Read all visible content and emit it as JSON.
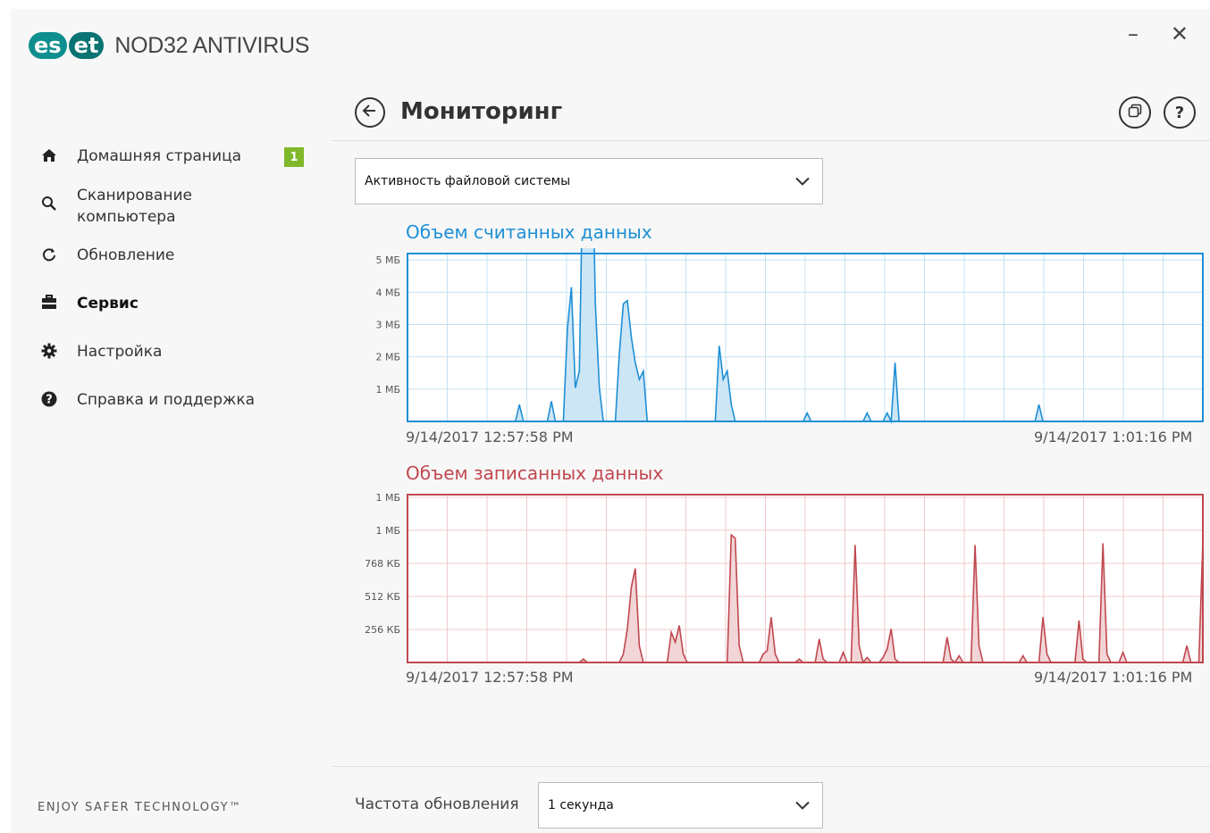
{
  "app": {
    "logo_left": "es",
    "logo_right": "et",
    "product": "NOD32 ANTIVIRUS",
    "minimize_label": "–",
    "close_label": "✕"
  },
  "sidebar": {
    "items": [
      {
        "label": "Домашняя страница",
        "icon": "home-icon",
        "badge": "1"
      },
      {
        "label": "Сканирование\nкомпьютера",
        "icon": "search-icon"
      },
      {
        "label": "Обновление",
        "icon": "refresh-icon"
      },
      {
        "label": "Сервис",
        "icon": "toolbox-icon",
        "active": true
      },
      {
        "label": "Настройка",
        "icon": "gear-icon"
      },
      {
        "label": "Справка и поддержка",
        "icon": "help-icon"
      }
    ],
    "tagline": "ENJOY SAFER TECHNOLOGY™"
  },
  "header": {
    "title": "Мониторинг",
    "back_icon": "back-arrow-icon",
    "help_symbol": "?"
  },
  "monitor": {
    "selected": "Активность файловой системы",
    "frequency_label": "Частота обновления",
    "frequency_value": "1 секунда"
  },
  "chart_data": [
    {
      "type": "area",
      "title": "Объем считанных данных",
      "color": "#1e8fd5",
      "fill": "#cde6f5",
      "grid": true,
      "ytick_labels": [
        "5 МБ",
        "4 МБ",
        "3 МБ",
        "2 МБ",
        "1 МБ"
      ],
      "ytick_values": [
        5,
        4,
        3,
        2,
        1
      ],
      "ylim": [
        0,
        5.2
      ],
      "unit": "МБ",
      "x_start": "9/14/2017 12:57:58 PM",
      "x_end": "9/14/2017 1:01:16 PM",
      "spikes": [
        [
          28,
          0.1
        ],
        [
          36,
          0.12
        ],
        [
          40,
          0.55
        ],
        [
          41,
          0.8
        ],
        [
          42,
          0.2
        ],
        [
          43,
          0.3
        ],
        [
          44,
          1.7
        ],
        [
          45,
          2.7
        ],
        [
          46,
          2.0
        ],
        [
          47,
          0.7
        ],
        [
          48,
          0.2
        ],
        [
          53,
          0.4
        ],
        [
          54,
          0.7
        ],
        [
          55,
          0.72
        ],
        [
          56,
          0.5
        ],
        [
          57,
          0.35
        ],
        [
          58,
          0.25
        ],
        [
          59,
          0.3
        ],
        [
          78,
          0.45
        ],
        [
          79,
          0.25
        ],
        [
          80,
          0.3
        ],
        [
          81,
          0.1
        ],
        [
          100,
          0.05
        ],
        [
          115,
          0.05
        ],
        [
          120,
          0.05
        ],
        [
          122,
          0.35
        ],
        [
          158,
          0.1
        ]
      ],
      "n": 200
    },
    {
      "type": "area",
      "title": "Объем записанных данных",
      "color": "#c0484f",
      "fill": "#f2d5d7",
      "grid": true,
      "ytick_labels": [
        "1 МБ",
        "1 МБ",
        "768 КБ",
        "512 КБ",
        "256 КБ"
      ],
      "ytick_values": [
        1280,
        1024,
        768,
        512,
        256
      ],
      "ylim": [
        0,
        1300
      ],
      "unit": "КБ",
      "x_start": "9/14/2017 12:57:58 PM",
      "x_end": "9/14/2017 1:01:16 PM",
      "spikes": [
        [
          44,
          0.02
        ],
        [
          54,
          0.05
        ],
        [
          55,
          0.2
        ],
        [
          56,
          0.45
        ],
        [
          57,
          0.56
        ],
        [
          58,
          0.1
        ],
        [
          66,
          0.18
        ],
        [
          67,
          0.12
        ],
        [
          68,
          0.22
        ],
        [
          69,
          0.05
        ],
        [
          81,
          0.76
        ],
        [
          82,
          0.74
        ],
        [
          83,
          0.1
        ],
        [
          89,
          0.05
        ],
        [
          90,
          0.07
        ],
        [
          91,
          0.27
        ],
        [
          92,
          0.05
        ],
        [
          98,
          0.02
        ],
        [
          103,
          0.14
        ],
        [
          104,
          0.02
        ],
        [
          109,
          0.06
        ],
        [
          112,
          0.7
        ],
        [
          113,
          0.1
        ],
        [
          115,
          0.03
        ],
        [
          119,
          0.03
        ],
        [
          120,
          0.08
        ],
        [
          121,
          0.2
        ],
        [
          122,
          0.02
        ],
        [
          135,
          0.15
        ],
        [
          136,
          0.02
        ],
        [
          138,
          0.04
        ],
        [
          142,
          0.7
        ],
        [
          143,
          0.1
        ],
        [
          154,
          0.04
        ],
        [
          159,
          0.27
        ],
        [
          160,
          0.05
        ],
        [
          168,
          0.25
        ],
        [
          169,
          0.02
        ],
        [
          174,
          0.71
        ],
        [
          175,
          0.05
        ],
        [
          179,
          0.06
        ],
        [
          195,
          0.1
        ],
        [
          199,
          0.72
        ]
      ],
      "n": 200
    }
  ]
}
